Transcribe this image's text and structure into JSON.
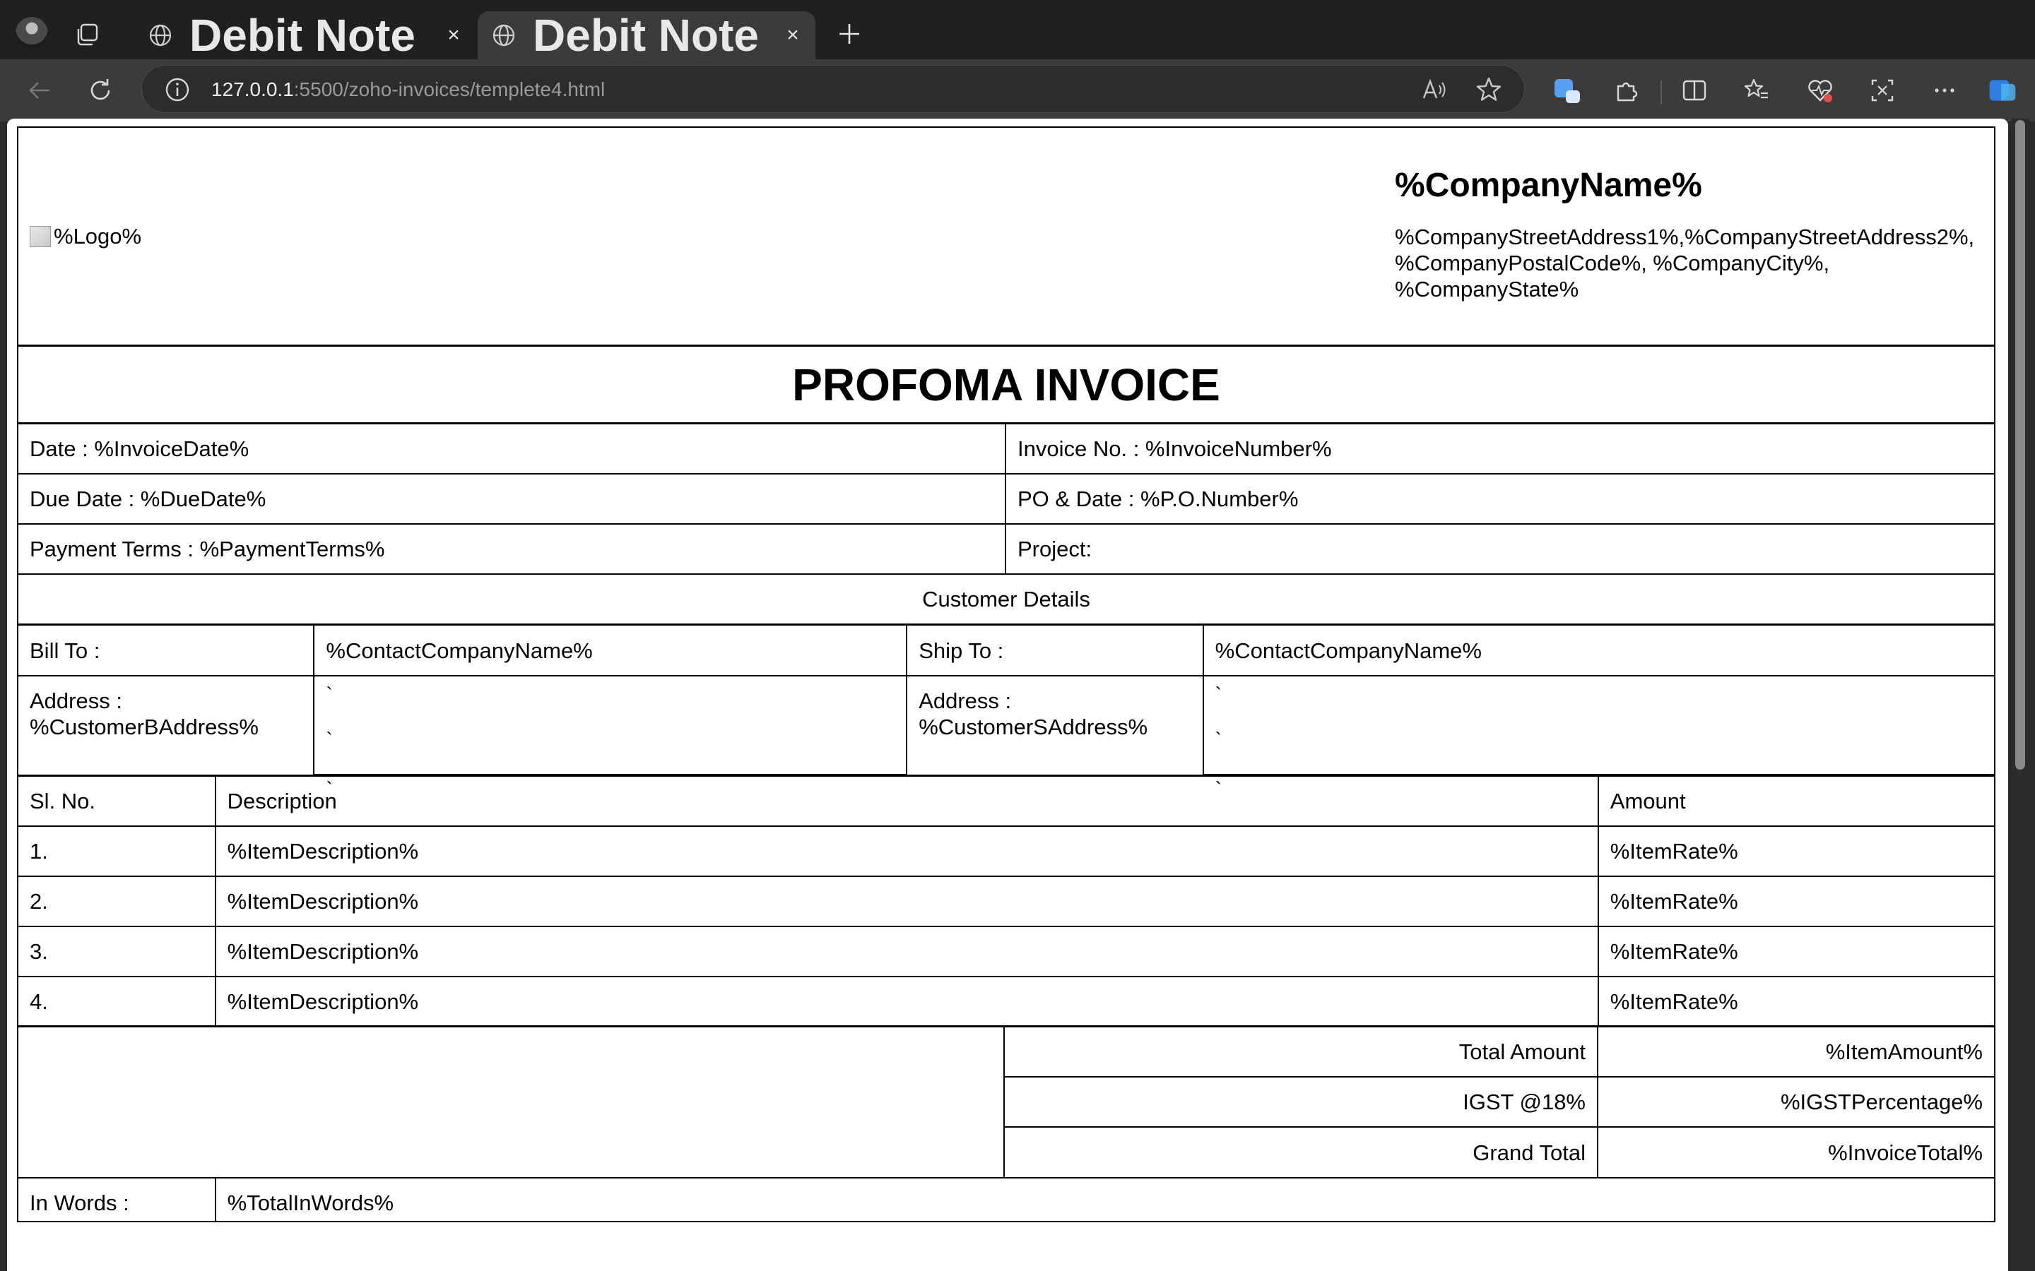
{
  "browser": {
    "tabs": [
      {
        "title": "Debit Note",
        "active": false
      },
      {
        "title": "Debit Note",
        "active": true
      }
    ],
    "url": {
      "host": "127.0.0.1",
      "path": ":5500/zoho-invoices/templete4.html"
    }
  },
  "invoice": {
    "logo_alt": "%Logo%",
    "company_name": "%CompanyName%",
    "company_address_line1": "%CompanyStreetAddress1%,%CompanyStreetAddress2%,",
    "company_address_line2": "%CompanyPostalCode%, %CompanyCity%,",
    "company_address_line3": "%CompanyState%",
    "title": "PROFOMA INVOICE",
    "date": "Date : %InvoiceDate%",
    "invoice_no": "Invoice No. : %InvoiceNumber%",
    "due_date": "Due Date : %DueDate%",
    "po_date": "PO & Date : %P.O.Number%",
    "payment_terms": "Payment Terms : %PaymentTerms%",
    "project": "Project:",
    "customer_details": "Customer Details",
    "bill_to_label": "Bill To :",
    "bill_to_value": "%ContactCompanyName%",
    "ship_to_label": "Ship To :",
    "ship_to_value": "%ContactCompanyName%",
    "bill_address_label": "Address :",
    "bill_address_value": "%CustomerBAddress%",
    "ship_address_label": "Address :",
    "ship_address_value": "%CustomerSAddress%",
    "tick": "`",
    "columns": {
      "sl_no": "Sl. No.",
      "description": "Description",
      "amount": "Amount"
    },
    "items": [
      {
        "no": "1.",
        "desc": "%ItemDescription%",
        "amount": "%ItemRate%"
      },
      {
        "no": "2.",
        "desc": "%ItemDescription%",
        "amount": "%ItemRate%"
      },
      {
        "no": "3.",
        "desc": "%ItemDescription%",
        "amount": "%ItemRate%"
      },
      {
        "no": "4.",
        "desc": "%ItemDescription%",
        "amount": "%ItemRate%"
      }
    ],
    "totals": [
      {
        "label": "Total Amount",
        "value": "%ItemAmount%"
      },
      {
        "label": "IGST @18%",
        "value": "%IGSTPercentage%"
      },
      {
        "label": "Grand Total",
        "value": "%InvoiceTotal%"
      }
    ],
    "in_words_label": "In Words :",
    "in_words_value": "%TotalInWords%"
  }
}
